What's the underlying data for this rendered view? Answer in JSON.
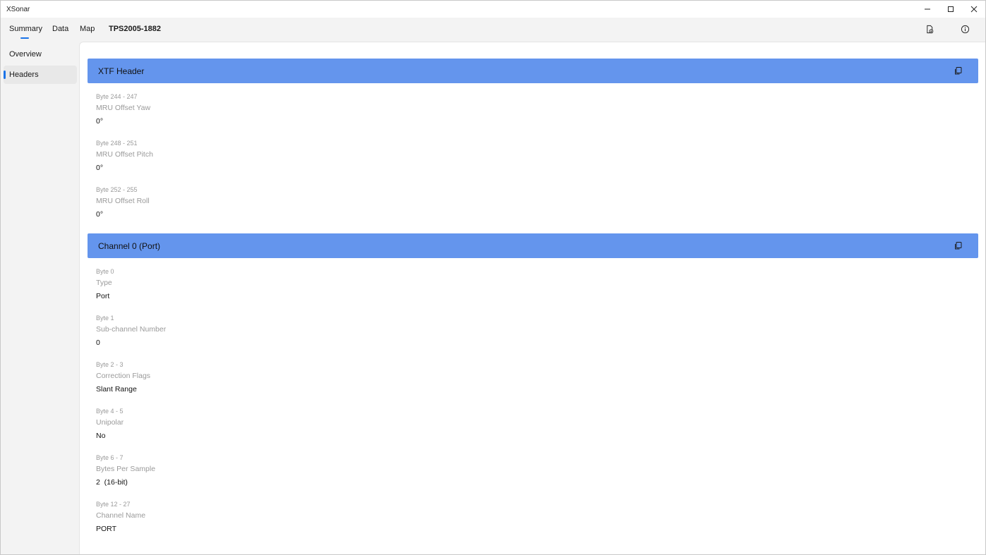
{
  "window": {
    "title": "XSonar",
    "controls": [
      "minimize-icon",
      "maximize-icon",
      "close-icon"
    ]
  },
  "nav": {
    "tabs": [
      {
        "label": "Summary",
        "active": true
      },
      {
        "label": "Data"
      },
      {
        "label": "Map"
      },
      {
        "label": "TPS2005-1882"
      }
    ],
    "icons": [
      "export-file-icon",
      "info-icon"
    ]
  },
  "sidebar": {
    "items": [
      {
        "label": "Overview"
      },
      {
        "label": "Headers",
        "active": true
      }
    ]
  },
  "sections": [
    {
      "title": "XTF Header",
      "icon": "copy-icon",
      "fields": [
        {
          "byte": "Byte 244 - 247",
          "label": "MRU Offset Yaw",
          "value": "0°"
        },
        {
          "byte": "Byte 248 - 251",
          "label": "MRU Offset Pitch",
          "value": "0°"
        },
        {
          "byte": "Byte 252 - 255",
          "label": "MRU Offset Roll",
          "value": "0°"
        }
      ]
    },
    {
      "title": "Channel 0 (Port)",
      "icon": "copy-icon",
      "fields": [
        {
          "byte": "Byte 0",
          "label": "Type",
          "value": "Port"
        },
        {
          "byte": "Byte 1",
          "label": "Sub-channel Number",
          "value": "0"
        },
        {
          "byte": "Byte 2 - 3",
          "label": "Correction Flags",
          "value": "Slant Range"
        },
        {
          "byte": "Byte 4 - 5",
          "label": "Unipolar",
          "value": "No"
        },
        {
          "byte": "Byte 6 - 7",
          "label": "Bytes Per Sample",
          "value": "2  (16-bit)"
        },
        {
          "byte": "Byte 12 - 27",
          "label": "Channel Name",
          "value": "PORT"
        }
      ]
    }
  ],
  "colors": {
    "section_header": "#6495ed",
    "accent": "#1a73e8",
    "muted_text": "#9a9a9a"
  }
}
